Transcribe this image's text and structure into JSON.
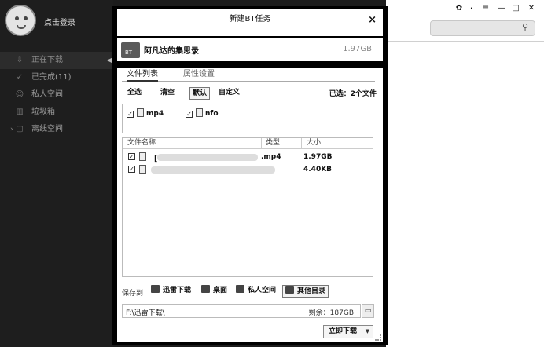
{
  "sidebar": {
    "login_label": "点击登录",
    "items": [
      {
        "label": "正在下载",
        "icon": "download-arrow-icon"
      },
      {
        "label": "已完成(11)",
        "icon": "check-circle-icon"
      },
      {
        "label": "私人空间",
        "icon": "person-icon"
      },
      {
        "label": "垃圾箱",
        "icon": "trash-icon"
      },
      {
        "label": "离线空间",
        "icon": "cloud-box-icon"
      }
    ]
  },
  "dialog": {
    "title": "新建BT任务",
    "close_label": "×",
    "task": {
      "icon_text": "BT",
      "name": "阿凡达的集思录",
      "size": "1.97GB"
    },
    "tabs": [
      "文件列表",
      "属性设置"
    ],
    "toolbar": {
      "select_all": "全选",
      "clear": "清空",
      "default": "默认",
      "custom": "自定义",
      "selected_info": "已选：2个文件"
    },
    "types": [
      {
        "label": "mp4",
        "checked": true
      },
      {
        "label": "nfo",
        "checked": true
      }
    ],
    "table": {
      "headers": {
        "name": "文件名称",
        "type": "类型",
        "size": "大小"
      },
      "rows": [
        {
          "name_prefix": "【",
          "name_suffix": ".mp4",
          "size": "1.97GB",
          "checked": true
        },
        {
          "name_prefix": "",
          "name_suffix": "",
          "size": "4.40KB",
          "checked": true
        }
      ]
    },
    "save": {
      "label": "保存到",
      "locations": [
        {
          "label": "迅雷下载",
          "icon": "thunder-folder-icon"
        },
        {
          "label": "桌面",
          "icon": "desktop-icon"
        },
        {
          "label": "私人空间",
          "icon": "private-space-icon"
        },
        {
          "label": "其他目录",
          "icon": "other-folder-icon"
        }
      ],
      "path": "F:\\迅雷下载\\",
      "free": "剩余：187GB"
    },
    "download_label": "立即下载",
    "dropdown_glyph": "▼"
  }
}
